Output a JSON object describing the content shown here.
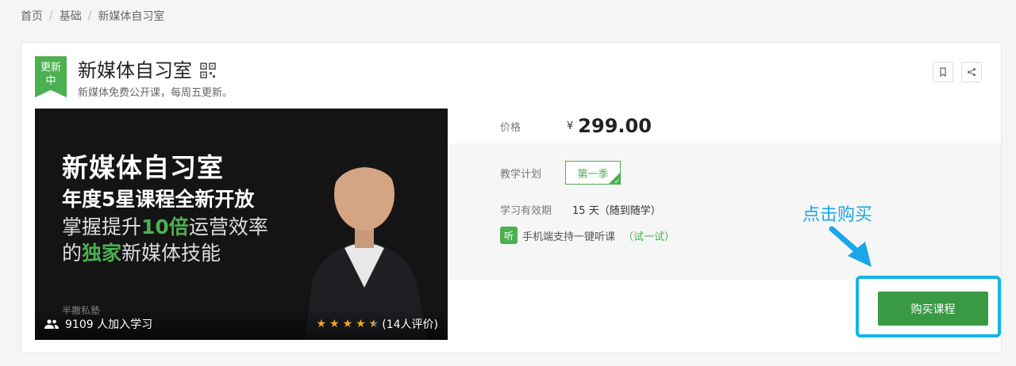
{
  "breadcrumb": [
    "首页",
    "基础",
    "新媒体自习室"
  ],
  "badge": {
    "line1": "更新",
    "line2": "中"
  },
  "course": {
    "title": "新媒体自习室",
    "subtitle": "新媒体免费公开课，每周五更新。"
  },
  "cover": {
    "line1": "新媒体自习室",
    "line2": "年度5星课程全新开放",
    "line3_pre": "掌握提升",
    "line3_hl": "10倍",
    "line3_post": "运营效率",
    "line4_pre": "的",
    "line4_hl": "独家",
    "line4_post": "新媒体技能",
    "watermark": "半撇私塾",
    "learners": "9109 人加入学习",
    "rating_value": 4.5,
    "reviews": "(14人评价)"
  },
  "pricing": {
    "label": "价格",
    "currency": "¥",
    "value": "299.00"
  },
  "plan": {
    "label": "教学计划",
    "season": "第一季"
  },
  "validity": {
    "label": "学习有效期",
    "value": "15 天（随到随学）"
  },
  "listen": {
    "badge": "听",
    "text": "手机端支持一键听课",
    "trial": "（试一试）"
  },
  "annotation": {
    "text": "点击购买"
  },
  "buy_button": "购买课程",
  "colors": {
    "green": "#4cb050",
    "button": "#3a9a44",
    "annotation": "#13b5ea"
  }
}
